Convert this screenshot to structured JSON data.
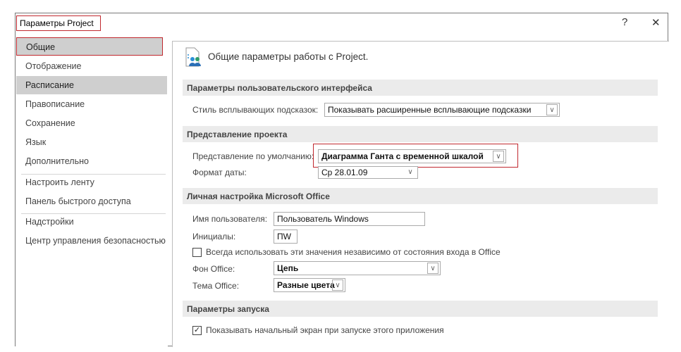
{
  "window": {
    "title": "Параметры Project",
    "help": "?",
    "close": "✕"
  },
  "sidebar": {
    "items": [
      {
        "label": "Общие"
      },
      {
        "label": "Отображение"
      },
      {
        "label": "Расписание"
      },
      {
        "label": "Правописание"
      },
      {
        "label": "Сохранение"
      },
      {
        "label": "Язык"
      },
      {
        "label": "Дополнительно"
      },
      {
        "label": "Настроить ленту"
      },
      {
        "label": "Панель быстрого доступа"
      },
      {
        "label": "Надстройки"
      },
      {
        "label": "Центр управления безопасностью"
      }
    ]
  },
  "main": {
    "heading": "Общие параметры работы с Project.",
    "sections": {
      "ui": {
        "title": "Параметры пользовательского интерфейса",
        "tooltip_label": "Стиль всплывающих подсказок:",
        "tooltip_value": "Показывать расширенные всплывающие подсказки"
      },
      "view": {
        "title": "Представление проекта",
        "default_view_label": "Представление по умолчанию:",
        "default_view_value": "Диаграмма Ганта с временной шкалой",
        "date_format_label": "Формат даты:",
        "date_format_value": "Ср 28.01.09"
      },
      "personal": {
        "title": "Личная настройка Microsoft Office",
        "username_label": "Имя пользователя:",
        "username_value": "Пользователь Windows",
        "initials_label": "Инициалы:",
        "initials_value": "ПW",
        "always_use_label": "Всегда использовать эти значения независимо от состояния входа в Office",
        "always_use_checked": false,
        "background_label": "Фон Office:",
        "background_value": "Цепь",
        "theme_label": "Тема Office:",
        "theme_value": "Разные цвета"
      },
      "startup": {
        "title": "Параметры запуска",
        "show_start_label": "Показывать начальный экран при запуске этого приложения",
        "show_start_checked": true
      }
    }
  }
}
